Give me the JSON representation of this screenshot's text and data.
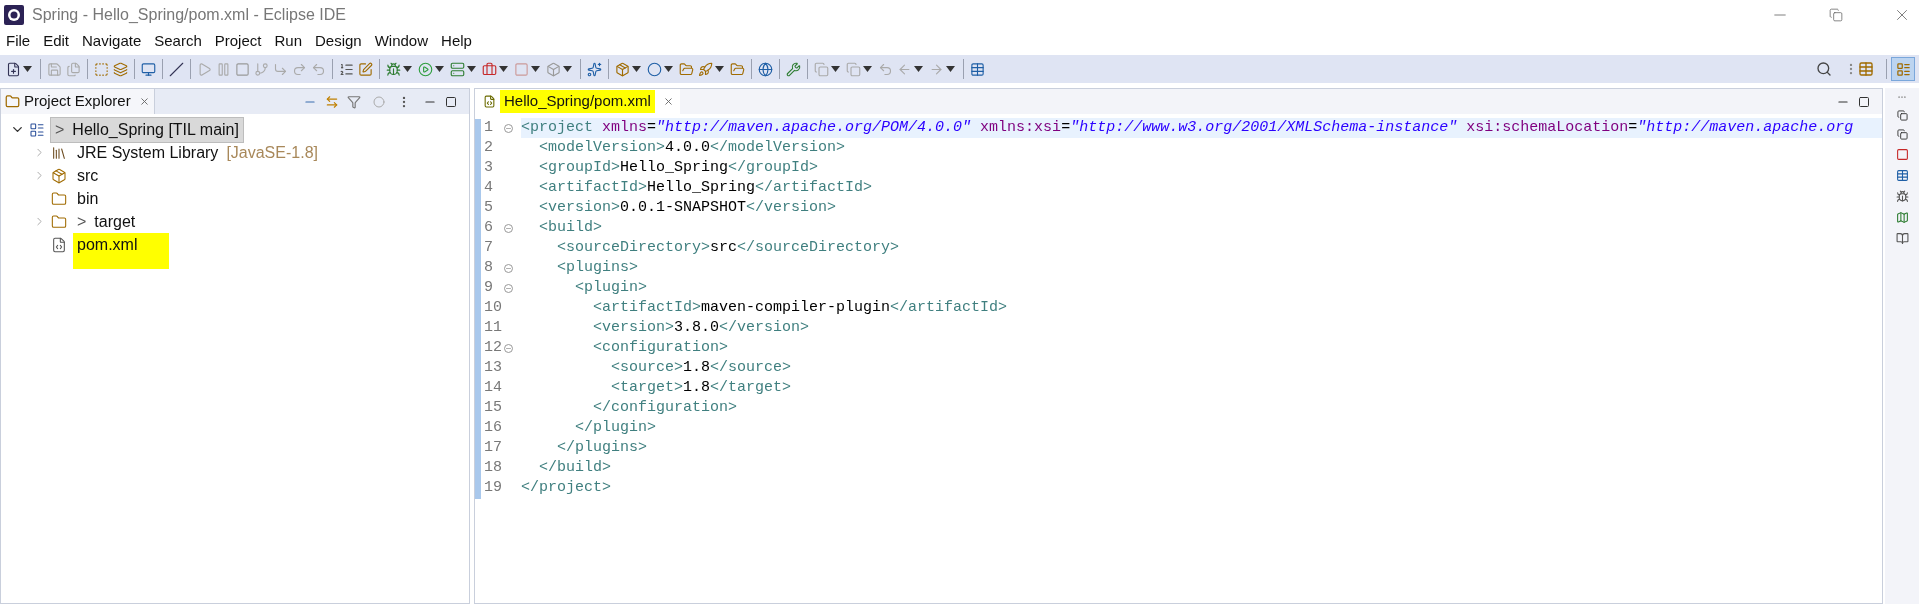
{
  "window": {
    "title": "Spring - Hello_Spring/pom.xml - Eclipse IDE"
  },
  "menu": [
    "File",
    "Edit",
    "Navigate",
    "Search",
    "Project",
    "Run",
    "Design",
    "Window",
    "Help"
  ],
  "project_explorer": {
    "title": "Project Explorer",
    "tree": [
      {
        "kind": "project",
        "prefix": ">",
        "label": "Hello_Spring [TIL main]",
        "expanded": true,
        "selected": true,
        "highlighted": false,
        "children": [
          {
            "kind": "library",
            "label": "JRE System Library",
            "decoration": "[JavaSE-1.8]",
            "expanded": false,
            "selected": false,
            "highlighted": false
          },
          {
            "kind": "source-folder",
            "label": "src",
            "expanded": false,
            "selected": false,
            "highlighted": false
          },
          {
            "kind": "folder",
            "label": "bin",
            "selected": false,
            "highlighted": false
          },
          {
            "kind": "unknown-folder",
            "prefix": ">",
            "label": "target",
            "expanded": false,
            "selected": false,
            "highlighted": false
          },
          {
            "kind": "xml-file",
            "label": "pom.xml",
            "selected": false,
            "highlighted": true
          }
        ]
      }
    ]
  },
  "editor": {
    "tab": {
      "label": "Hello_Spring/pom.xml",
      "selected": true,
      "highlighted": true
    },
    "lines": [
      {
        "number": "1",
        "foldable": true,
        "current": true,
        "tokens": [
          {
            "kind": "tag",
            "text": "<project"
          },
          {
            "kind": "attr",
            "text": " xmlns"
          },
          {
            "kind": "text",
            "text": "="
          },
          {
            "kind": "value",
            "text": "\"http://maven.apache.org/POM/4.0.0\""
          },
          {
            "kind": "attr",
            "text": " xmlns:xsi"
          },
          {
            "kind": "text",
            "text": "="
          },
          {
            "kind": "value",
            "text": "\"http://www.w3.org/2001/XMLSchema-instance\""
          },
          {
            "kind": "attr",
            "text": " xsi:schemaLocation"
          },
          {
            "kind": "text",
            "text": "="
          },
          {
            "kind": "value",
            "text": "\"http://maven.apache.org"
          }
        ]
      },
      {
        "number": "2",
        "foldable": false,
        "current": false,
        "tokens": [
          {
            "kind": "tag",
            "text": "  <modelVersion>"
          },
          {
            "kind": "text",
            "text": "4.0.0"
          },
          {
            "kind": "tag",
            "text": "</modelVersion>"
          }
        ]
      },
      {
        "number": "3",
        "foldable": false,
        "current": false,
        "tokens": [
          {
            "kind": "tag",
            "text": "  <groupId>"
          },
          {
            "kind": "text",
            "text": "Hello_Spring"
          },
          {
            "kind": "tag",
            "text": "</groupId>"
          }
        ]
      },
      {
        "number": "4",
        "foldable": false,
        "current": false,
        "tokens": [
          {
            "kind": "tag",
            "text": "  <artifactId>"
          },
          {
            "kind": "text",
            "text": "Hello_Spring"
          },
          {
            "kind": "tag",
            "text": "</artifactId>"
          }
        ]
      },
      {
        "number": "5",
        "foldable": false,
        "current": false,
        "tokens": [
          {
            "kind": "tag",
            "text": "  <version>"
          },
          {
            "kind": "text",
            "text": "0.0.1-SNAPSHOT"
          },
          {
            "kind": "tag",
            "text": "</version>"
          }
        ]
      },
      {
        "number": "6",
        "foldable": true,
        "current": false,
        "tokens": [
          {
            "kind": "tag",
            "text": "  <build>"
          }
        ]
      },
      {
        "number": "7",
        "foldable": false,
        "current": false,
        "tokens": [
          {
            "kind": "tag",
            "text": "    <sourceDirectory>"
          },
          {
            "kind": "text",
            "text": "src"
          },
          {
            "kind": "tag",
            "text": "</sourceDirectory>"
          }
        ]
      },
      {
        "number": "8",
        "foldable": true,
        "current": false,
        "tokens": [
          {
            "kind": "tag",
            "text": "    <plugins>"
          }
        ]
      },
      {
        "number": "9",
        "foldable": true,
        "current": false,
        "tokens": [
          {
            "kind": "tag",
            "text": "      <plugin>"
          }
        ]
      },
      {
        "number": "10",
        "foldable": false,
        "current": false,
        "tokens": [
          {
            "kind": "tag",
            "text": "        <artifactId>"
          },
          {
            "kind": "text",
            "text": "maven-compiler-plugin"
          },
          {
            "kind": "tag",
            "text": "</artifactId>"
          }
        ]
      },
      {
        "number": "11",
        "foldable": false,
        "current": false,
        "tokens": [
          {
            "kind": "tag",
            "text": "        <version>"
          },
          {
            "kind": "text",
            "text": "3.8.0"
          },
          {
            "kind": "tag",
            "text": "</version>"
          }
        ]
      },
      {
        "number": "12",
        "foldable": true,
        "current": false,
        "tokens": [
          {
            "kind": "tag",
            "text": "        <configuration>"
          }
        ]
      },
      {
        "number": "13",
        "foldable": false,
        "current": false,
        "tokens": [
          {
            "kind": "tag",
            "text": "          <source>"
          },
          {
            "kind": "text",
            "text": "1.8"
          },
          {
            "kind": "tag",
            "text": "</source>"
          }
        ]
      },
      {
        "number": "14",
        "foldable": false,
        "current": false,
        "tokens": [
          {
            "kind": "tag",
            "text": "          <target>"
          },
          {
            "kind": "text",
            "text": "1.8"
          },
          {
            "kind": "tag",
            "text": "</target>"
          }
        ]
      },
      {
        "number": "15",
        "foldable": false,
        "current": false,
        "tokens": [
          {
            "kind": "tag",
            "text": "        </configuration>"
          }
        ]
      },
      {
        "number": "16",
        "foldable": false,
        "current": false,
        "tokens": [
          {
            "kind": "tag",
            "text": "      </plugin>"
          }
        ]
      },
      {
        "number": "17",
        "foldable": false,
        "current": false,
        "tokens": [
          {
            "kind": "tag",
            "text": "    </plugins>"
          }
        ]
      },
      {
        "number": "18",
        "foldable": false,
        "current": false,
        "tokens": [
          {
            "kind": "tag",
            "text": "  </build>"
          }
        ]
      },
      {
        "number": "19",
        "foldable": false,
        "current": false,
        "tokens": [
          {
            "kind": "tag",
            "text": "</project>"
          }
        ]
      }
    ]
  }
}
